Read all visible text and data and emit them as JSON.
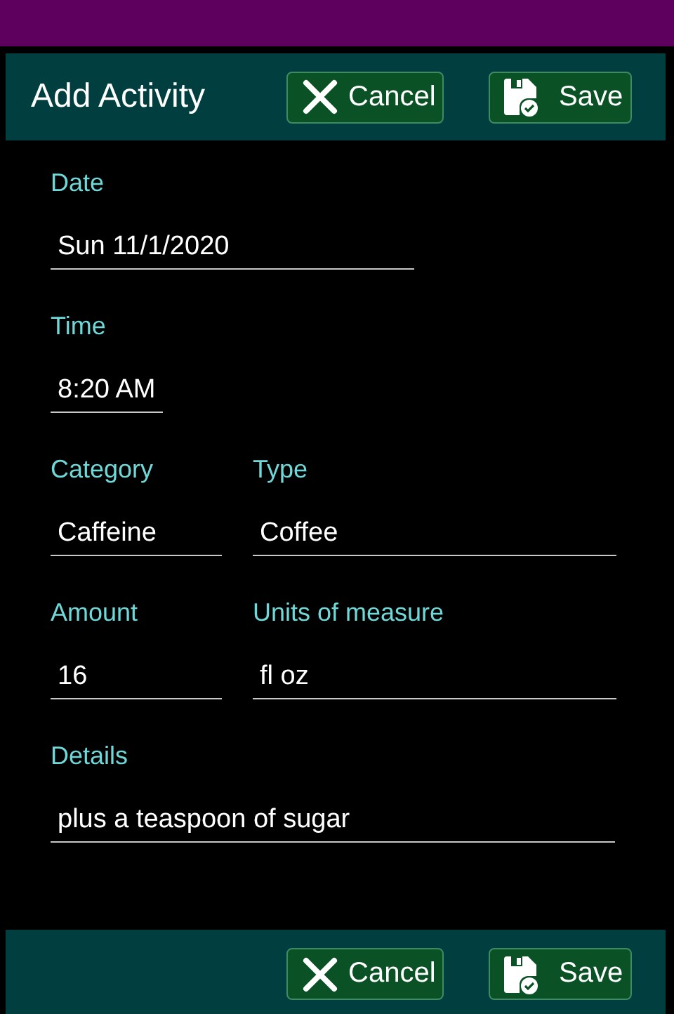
{
  "header": {
    "title": "Add Activity",
    "buttons": [
      {
        "kind": "cancel",
        "label": "Cancel"
      },
      {
        "kind": "save",
        "label": "Save"
      }
    ]
  },
  "form": {
    "rows": [
      {
        "fields": [
          {
            "kind": "medium",
            "label": "Date",
            "value": "Sun 11/1/2020"
          }
        ]
      },
      {
        "fields": [
          {
            "kind": "small",
            "label": "Time",
            "value": "8:20 AM"
          }
        ]
      },
      {
        "fields": [
          {
            "kind": "narrow",
            "label": "Category",
            "value": "Caffeine"
          },
          {
            "kind": "medium",
            "label": "Type",
            "value": "Coffee"
          }
        ]
      },
      {
        "fields": [
          {
            "kind": "narrow",
            "label": "Amount",
            "value": "16"
          },
          {
            "kind": "medium",
            "label": "Units of measure",
            "value": "fl oz"
          }
        ]
      },
      {
        "fields": [
          {
            "kind": "full",
            "label": "Details",
            "value": "plus a teaspoon of sugar"
          }
        ]
      }
    ]
  },
  "footer": {
    "buttons": [
      {
        "kind": "cancel",
        "label": "Cancel"
      },
      {
        "kind": "save",
        "label": "Save"
      }
    ]
  }
}
